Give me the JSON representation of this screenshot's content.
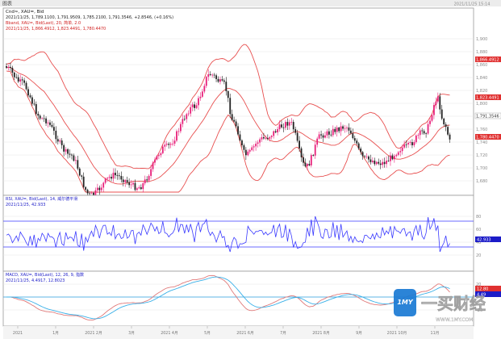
{
  "window": {
    "title": "图表",
    "corner_text": "2021/11/25 15:14"
  },
  "price_panel": {
    "title": "Cnd≈, XAU=, Bid",
    "info_line": "2021/11/25, 1,789.1100, 1,791.9509, 1,785.2100, 1,791.3546, +2.8546, (+0.16%)",
    "bb_title": "Bband, XAU=, Bid(Last), 20, 简单, 2.0",
    "bb_values": "2021/11/25, 1,866.4912, 1,823.4491, 1,780.4470",
    "price_ticks": [
      "1,900",
      "1,880",
      "1,860",
      "1,840",
      "1,820",
      "1,800",
      "1,780",
      "1,760",
      "1,740",
      "1,720",
      "1,700",
      "1,680"
    ],
    "badges": [
      {
        "label": "1,866.4912",
        "color": "#e03030",
        "text_color": "#ffffff"
      },
      {
        "label": "1,823.4491",
        "color": "#e03030",
        "text_color": "#ffffff"
      },
      {
        "label": "1,791.3546",
        "color": "#ffffff",
        "text_color": "#333333"
      },
      {
        "label": "1,780.4470",
        "color": "#e03030",
        "text_color": "#ffffff"
      }
    ]
  },
  "rsi_panel": {
    "title": "RSI, XAU=, Bid(Last), 14, 威尔德平滑",
    "values": "2021/11/25, 42.933",
    "ticks": [
      "80",
      "60",
      "40",
      "20"
    ],
    "badge": {
      "label": "42.933",
      "color": "#1c1cc8",
      "text_color": "#ffffff"
    }
  },
  "macd_panel": {
    "title": "MACD, XAU=, Bid(Last), 12, 26, 9, 指数",
    "values": "2021/11/25, 4.4917, 12.8023",
    "ticks": [
      "20",
      "0",
      "-20"
    ],
    "badges": [
      {
        "label": "12.80",
        "color": "#e03030",
        "text_color": "#ffffff"
      },
      {
        "label": "4.49",
        "color": "#1c1cc8",
        "text_color": "#ffffff"
      }
    ]
  },
  "time_axis": [
    "2021",
    "1月",
    "2021 2月",
    "3月",
    "2021 4月",
    "5月",
    "2021 6月",
    "7月",
    "2021 8月",
    "9月",
    "2021 10月",
    "11月"
  ],
  "watermark": {
    "text": "一买财经",
    "url": "WWW.1MY.COM",
    "logo": "1MY"
  },
  "colors": {
    "up_candle": "#e8207a",
    "down_candle": "#222222",
    "band": "#e85050",
    "rsi_line": "#3a3aff",
    "macd_line": "#e07a7a",
    "signal_line": "#3ab0e8",
    "grid": "#e6e6e6",
    "panel_border": "#9a9a9a",
    "brand": "#1a7ad4"
  }
}
